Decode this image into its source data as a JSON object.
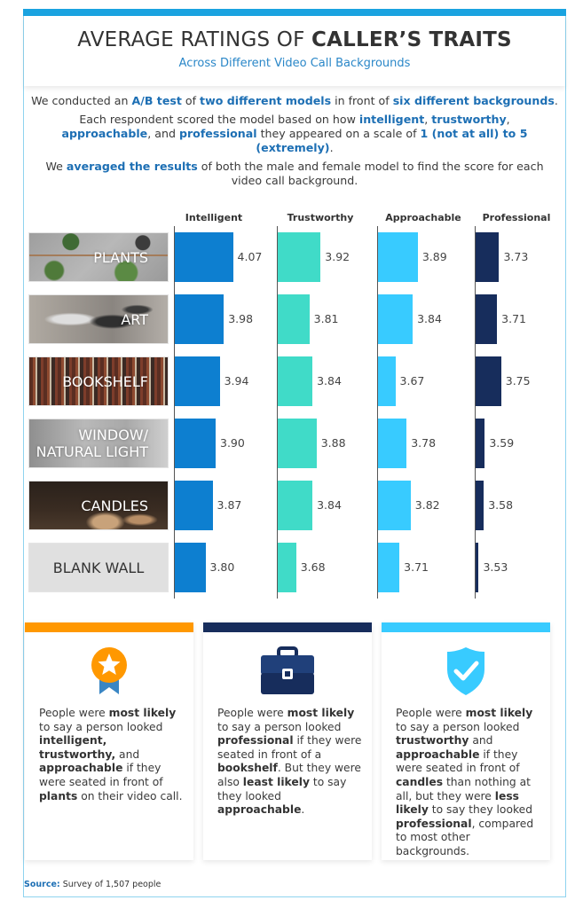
{
  "header": {
    "title_plain": "AVERAGE RATINGS OF ",
    "title_bold": "CALLER’S TRAITS",
    "subtitle": "Across Different Video Call Backgrounds"
  },
  "intro": {
    "p1": [
      {
        "t": "We conducted an ",
        "b": false
      },
      {
        "t": "A/B test",
        "b": true
      },
      {
        "t": " of ",
        "b": false
      },
      {
        "t": "two different models",
        "b": true
      },
      {
        "t": " in front of ",
        "b": false
      },
      {
        "t": "six different backgrounds",
        "b": true
      },
      {
        "t": ".",
        "b": false
      }
    ],
    "p2": [
      {
        "t": "Each respondent scored the model based on how ",
        "b": false
      },
      {
        "t": "intelligent",
        "b": true
      },
      {
        "t": ", ",
        "b": false
      },
      {
        "t": "trustworthy",
        "b": true
      },
      {
        "t": ", ",
        "b": false
      },
      {
        "t": "approachable",
        "b": true
      },
      {
        "t": ", and ",
        "b": false
      },
      {
        "t": "professional",
        "b": true
      },
      {
        "t": " they appeared on a scale of ",
        "b": false
      },
      {
        "t": "1 (not at all) to 5 (extremely)",
        "b": true
      },
      {
        "t": ".",
        "b": false
      }
    ],
    "p3": [
      {
        "t": "We ",
        "b": false
      },
      {
        "t": "averaged the results",
        "b": true
      },
      {
        "t": " of both the male and female model to find the score for each video call background.",
        "b": false
      }
    ]
  },
  "chart_data": {
    "type": "bar",
    "orientation": "horizontal",
    "title": "AVERAGE RATINGS OF CALLER’S TRAITS",
    "subtitle": "Across Different Video Call Backgrounds",
    "xlabel": "",
    "ylabel": "",
    "scale": "1 (not at all) to 5 (extremely)",
    "axis_baseline": 3.5,
    "categories": [
      "PLANTS",
      "ART",
      "BOOKSHELF",
      "WINDOW/ NATURAL LIGHT",
      "CANDLES",
      "BLANK WALL"
    ],
    "series": [
      {
        "name": "Intelligent",
        "color": "#0d7fd0",
        "values": [
          4.07,
          3.98,
          3.94,
          3.9,
          3.87,
          3.8
        ]
      },
      {
        "name": "Trustworthy",
        "color": "#40dbc8",
        "values": [
          3.92,
          3.81,
          3.84,
          3.88,
          3.84,
          3.68
        ]
      },
      {
        "name": "Approachable",
        "color": "#38cbff",
        "values": [
          3.89,
          3.84,
          3.67,
          3.78,
          3.82,
          3.71
        ]
      },
      {
        "name": "Professional",
        "color": "#172d5c",
        "values": [
          3.73,
          3.71,
          3.75,
          3.59,
          3.58,
          3.53
        ]
      }
    ],
    "value_labels": [
      [
        "4.07",
        "3.92",
        "3.89",
        "3.73"
      ],
      [
        "3.98",
        "3.81",
        "3.84",
        "3.71"
      ],
      [
        "3.94",
        "3.84",
        "3.67",
        "3.75"
      ],
      [
        "3.90",
        "3.88",
        "3.78",
        "3.59"
      ],
      [
        "3.87",
        "3.84",
        "3.82",
        "3.58"
      ],
      [
        "3.80",
        "3.68",
        "3.71",
        "3.53"
      ]
    ],
    "grid": false,
    "legend": "column-headers-top"
  },
  "cards": [
    {
      "accent": "#ff9800",
      "icon": "award-ribbon-icon",
      "text": [
        {
          "t": "People were ",
          "b": false
        },
        {
          "t": "most likely",
          "b": true
        },
        {
          "t": " to say a person looked ",
          "b": false
        },
        {
          "t": "intelligent, trustworthy,",
          "b": true
        },
        {
          "t": " and ",
          "b": false
        },
        {
          "t": "approachable",
          "b": true
        },
        {
          "t": " if they were seated in front of ",
          "b": false
        },
        {
          "t": "plants",
          "b": true
        },
        {
          "t": " on their video call.",
          "b": false
        }
      ]
    },
    {
      "accent": "#172d5c",
      "icon": "briefcase-icon",
      "text": [
        {
          "t": "People were ",
          "b": false
        },
        {
          "t": "most likely",
          "b": true
        },
        {
          "t": " to say a person looked ",
          "b": false
        },
        {
          "t": "professional",
          "b": true
        },
        {
          "t": " if they were seated in front of a ",
          "b": false
        },
        {
          "t": "bookshelf",
          "b": true
        },
        {
          "t": ". But they were also ",
          "b": false
        },
        {
          "t": "least likely",
          "b": true
        },
        {
          "t": " to say they looked ",
          "b": false
        },
        {
          "t": "approachable",
          "b": true
        },
        {
          "t": ".",
          "b": false
        }
      ]
    },
    {
      "accent": "#38cbff",
      "icon": "shield-check-icon",
      "text": [
        {
          "t": "People were ",
          "b": false
        },
        {
          "t": "most likely",
          "b": true
        },
        {
          "t": " to say a person looked ",
          "b": false
        },
        {
          "t": "trustworthy",
          "b": true
        },
        {
          "t": " and ",
          "b": false
        },
        {
          "t": "approachable",
          "b": true
        },
        {
          "t": " if they were seated in front of ",
          "b": false
        },
        {
          "t": "candles",
          "b": true
        },
        {
          "t": " than nothing at all, but they were ",
          "b": false
        },
        {
          "t": "less likely",
          "b": true
        },
        {
          "t": " to say they looked ",
          "b": false
        },
        {
          "t": "professional",
          "b": true
        },
        {
          "t": ", compared to most other backgrounds.",
          "b": false
        }
      ]
    }
  ],
  "source": {
    "label": "Source:",
    "text": " Survey of 1,507 people"
  },
  "colors": {
    "top_bar": "#1aa3e0",
    "highlight_text": "#1d6fb4",
    "subtitle": "#2a87c8"
  }
}
